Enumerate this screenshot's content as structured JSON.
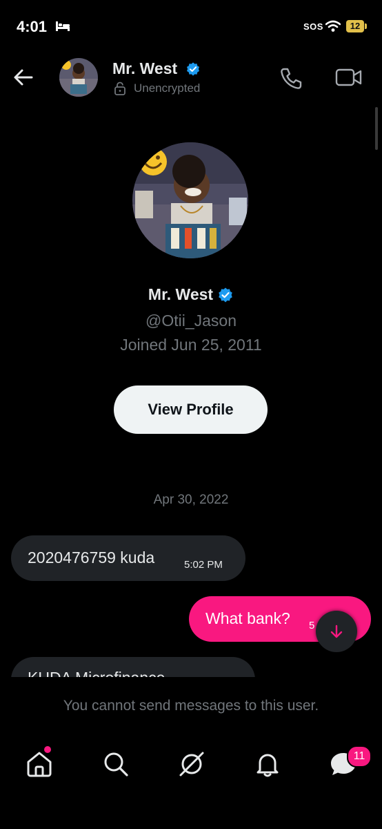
{
  "status_bar": {
    "time": "4:01",
    "sos": "SOS",
    "battery": "12"
  },
  "header": {
    "name": "Mr. West",
    "encryption_status": "Unencrypted",
    "icons": [
      "back-arrow-icon",
      "verified-badge-icon",
      "lock-icon",
      "phone-icon",
      "video-camera-icon"
    ]
  },
  "profile": {
    "name": "Mr. West",
    "handle": "@Otii_Jason",
    "joined": "Joined Jun 25, 2011",
    "view_profile_label": "View Profile"
  },
  "conversation": {
    "date_divider": "Apr 30, 2022",
    "messages": [
      {
        "direction": "incoming",
        "text": "2020476759 kuda",
        "time": "5:02 PM"
      },
      {
        "direction": "outgoing",
        "text": "What bank?",
        "time": "5"
      },
      {
        "direction": "incoming",
        "text": "KUDA Microfinance"
      }
    ]
  },
  "composer": {
    "notice": "You cannot send messages to this user."
  },
  "bottom_nav": {
    "items": [
      "home-icon",
      "search-icon",
      "grok-icon",
      "notifications-icon",
      "messages-icon"
    ],
    "messages_badge": "11"
  },
  "colors": {
    "background": "#000000",
    "accent_pink": "#f91880",
    "verified_blue": "#1d9bf0",
    "bubble_incoming": "#202327",
    "secondary_text": "#71767b"
  }
}
